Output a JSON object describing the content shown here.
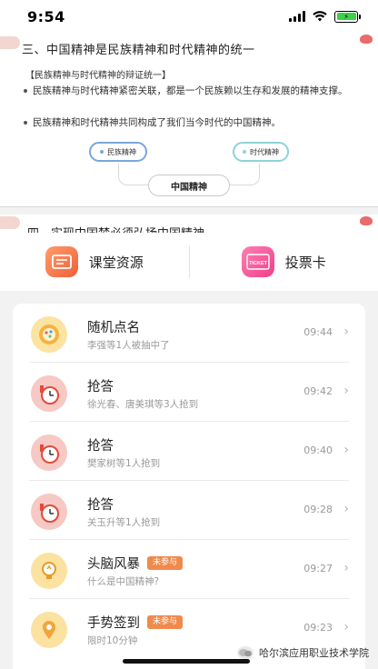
{
  "status_bar": {
    "time": "9:54",
    "battery_color": "#3bd14a"
  },
  "slide1": {
    "title": "三、中国精神是民族精神和时代精神的统一",
    "subhead": "【民族精神与时代精神的辩证统一】",
    "bullets": [
      "民族精神与时代精神紧密关联，都是一个民族赖以生存和发展的精神支撑。",
      "民族精神和时代精神共同构成了我们当今时代的中国精神。"
    ],
    "pill_left": "民族精神",
    "pill_right": "时代精神",
    "center": "中国精神"
  },
  "slide2": {
    "title": "四、实现中国梦必须弘扬中国精神"
  },
  "resources": [
    {
      "label": "课堂资源",
      "icon": "resource-icon"
    },
    {
      "label": "投票卡",
      "icon": "ticket-icon",
      "icon_text": "TICKET"
    }
  ],
  "activities": [
    {
      "name": "随机点名",
      "desc": "李强等1人被抽中了",
      "time": "09:44",
      "icon": "random-call-icon",
      "badge": ""
    },
    {
      "name": "抢答",
      "desc": "徐光春、唐美琪等3人抢到",
      "time": "09:42",
      "icon": "quick-answer-icon",
      "badge": ""
    },
    {
      "name": "抢答",
      "desc": "樊家树等1人抢到",
      "time": "09:40",
      "icon": "quick-answer-icon",
      "badge": ""
    },
    {
      "name": "抢答",
      "desc": "关玉升等1人抢到",
      "time": "09:28",
      "icon": "quick-answer-icon",
      "badge": ""
    },
    {
      "name": "头脑风暴",
      "desc": "什么是中国精神?",
      "time": "09:27",
      "icon": "brainstorm-icon",
      "badge": "未参与"
    },
    {
      "name": "手势签到",
      "desc": "限时10分钟",
      "time": "09:23",
      "icon": "gesture-signin-icon",
      "badge": "未参与"
    }
  ],
  "watermark": "哈尔滨应用职业技术学院",
  "colors": {
    "badge": "#f08a4b",
    "accent_orange": "#f0603b",
    "accent_pink": "#ef3f8a"
  }
}
